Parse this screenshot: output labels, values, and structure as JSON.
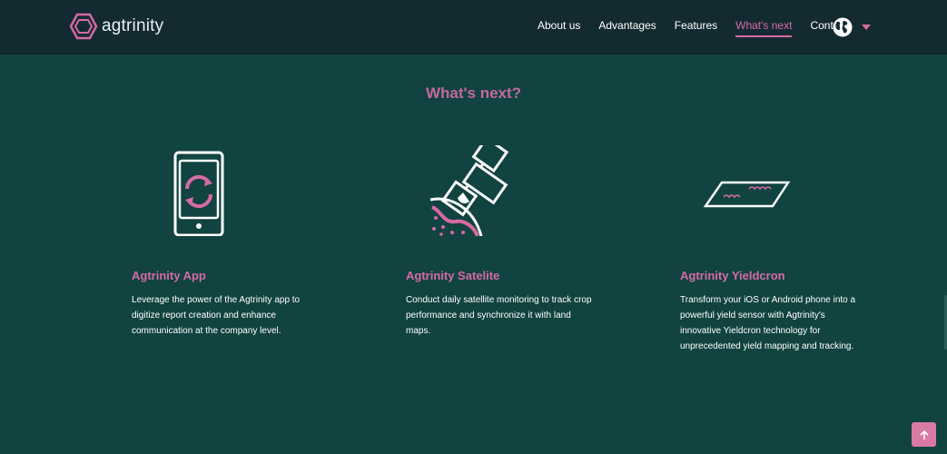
{
  "brand": {
    "name": "agtrinity",
    "logo_icon": "hexagon-logo-icon",
    "accent": "#d66ba0"
  },
  "nav": {
    "items": [
      {
        "label": "About us",
        "active": false
      },
      {
        "label": "Advantages",
        "active": false
      },
      {
        "label": "Features",
        "active": false
      },
      {
        "label": "What's next",
        "active": true
      },
      {
        "label": "Contact",
        "active": false
      }
    ],
    "language_icon": "globe-icon",
    "dropdown_icon": "caret-down-icon"
  },
  "section": {
    "title": "What's next?",
    "cards": [
      {
        "icon": "phone-sync-icon",
        "title": "Agtrinity App",
        "text": "Leverage the power of the Agtrinity app to digitize report creation and enhance communication at the company level."
      },
      {
        "icon": "satellite-icon",
        "title": "Agtrinity Satelite",
        "text": "Conduct daily satellite monitoring to track crop performance and synchronize it with land maps."
      },
      {
        "icon": "yield-sensor-icon",
        "title": "Agtrinity Yieldcron",
        "text": "Transform your iOS or Android phone into a powerful yield sensor with Agtrinity's innovative Yieldcron technology for unprecedented yield mapping and tracking."
      }
    ]
  },
  "back_to_top": {
    "icon": "arrow-up-icon"
  },
  "colors": {
    "background": "#114340",
    "navbar": "#142a31",
    "accent": "#d66ba0",
    "title": "#c46a9b"
  }
}
